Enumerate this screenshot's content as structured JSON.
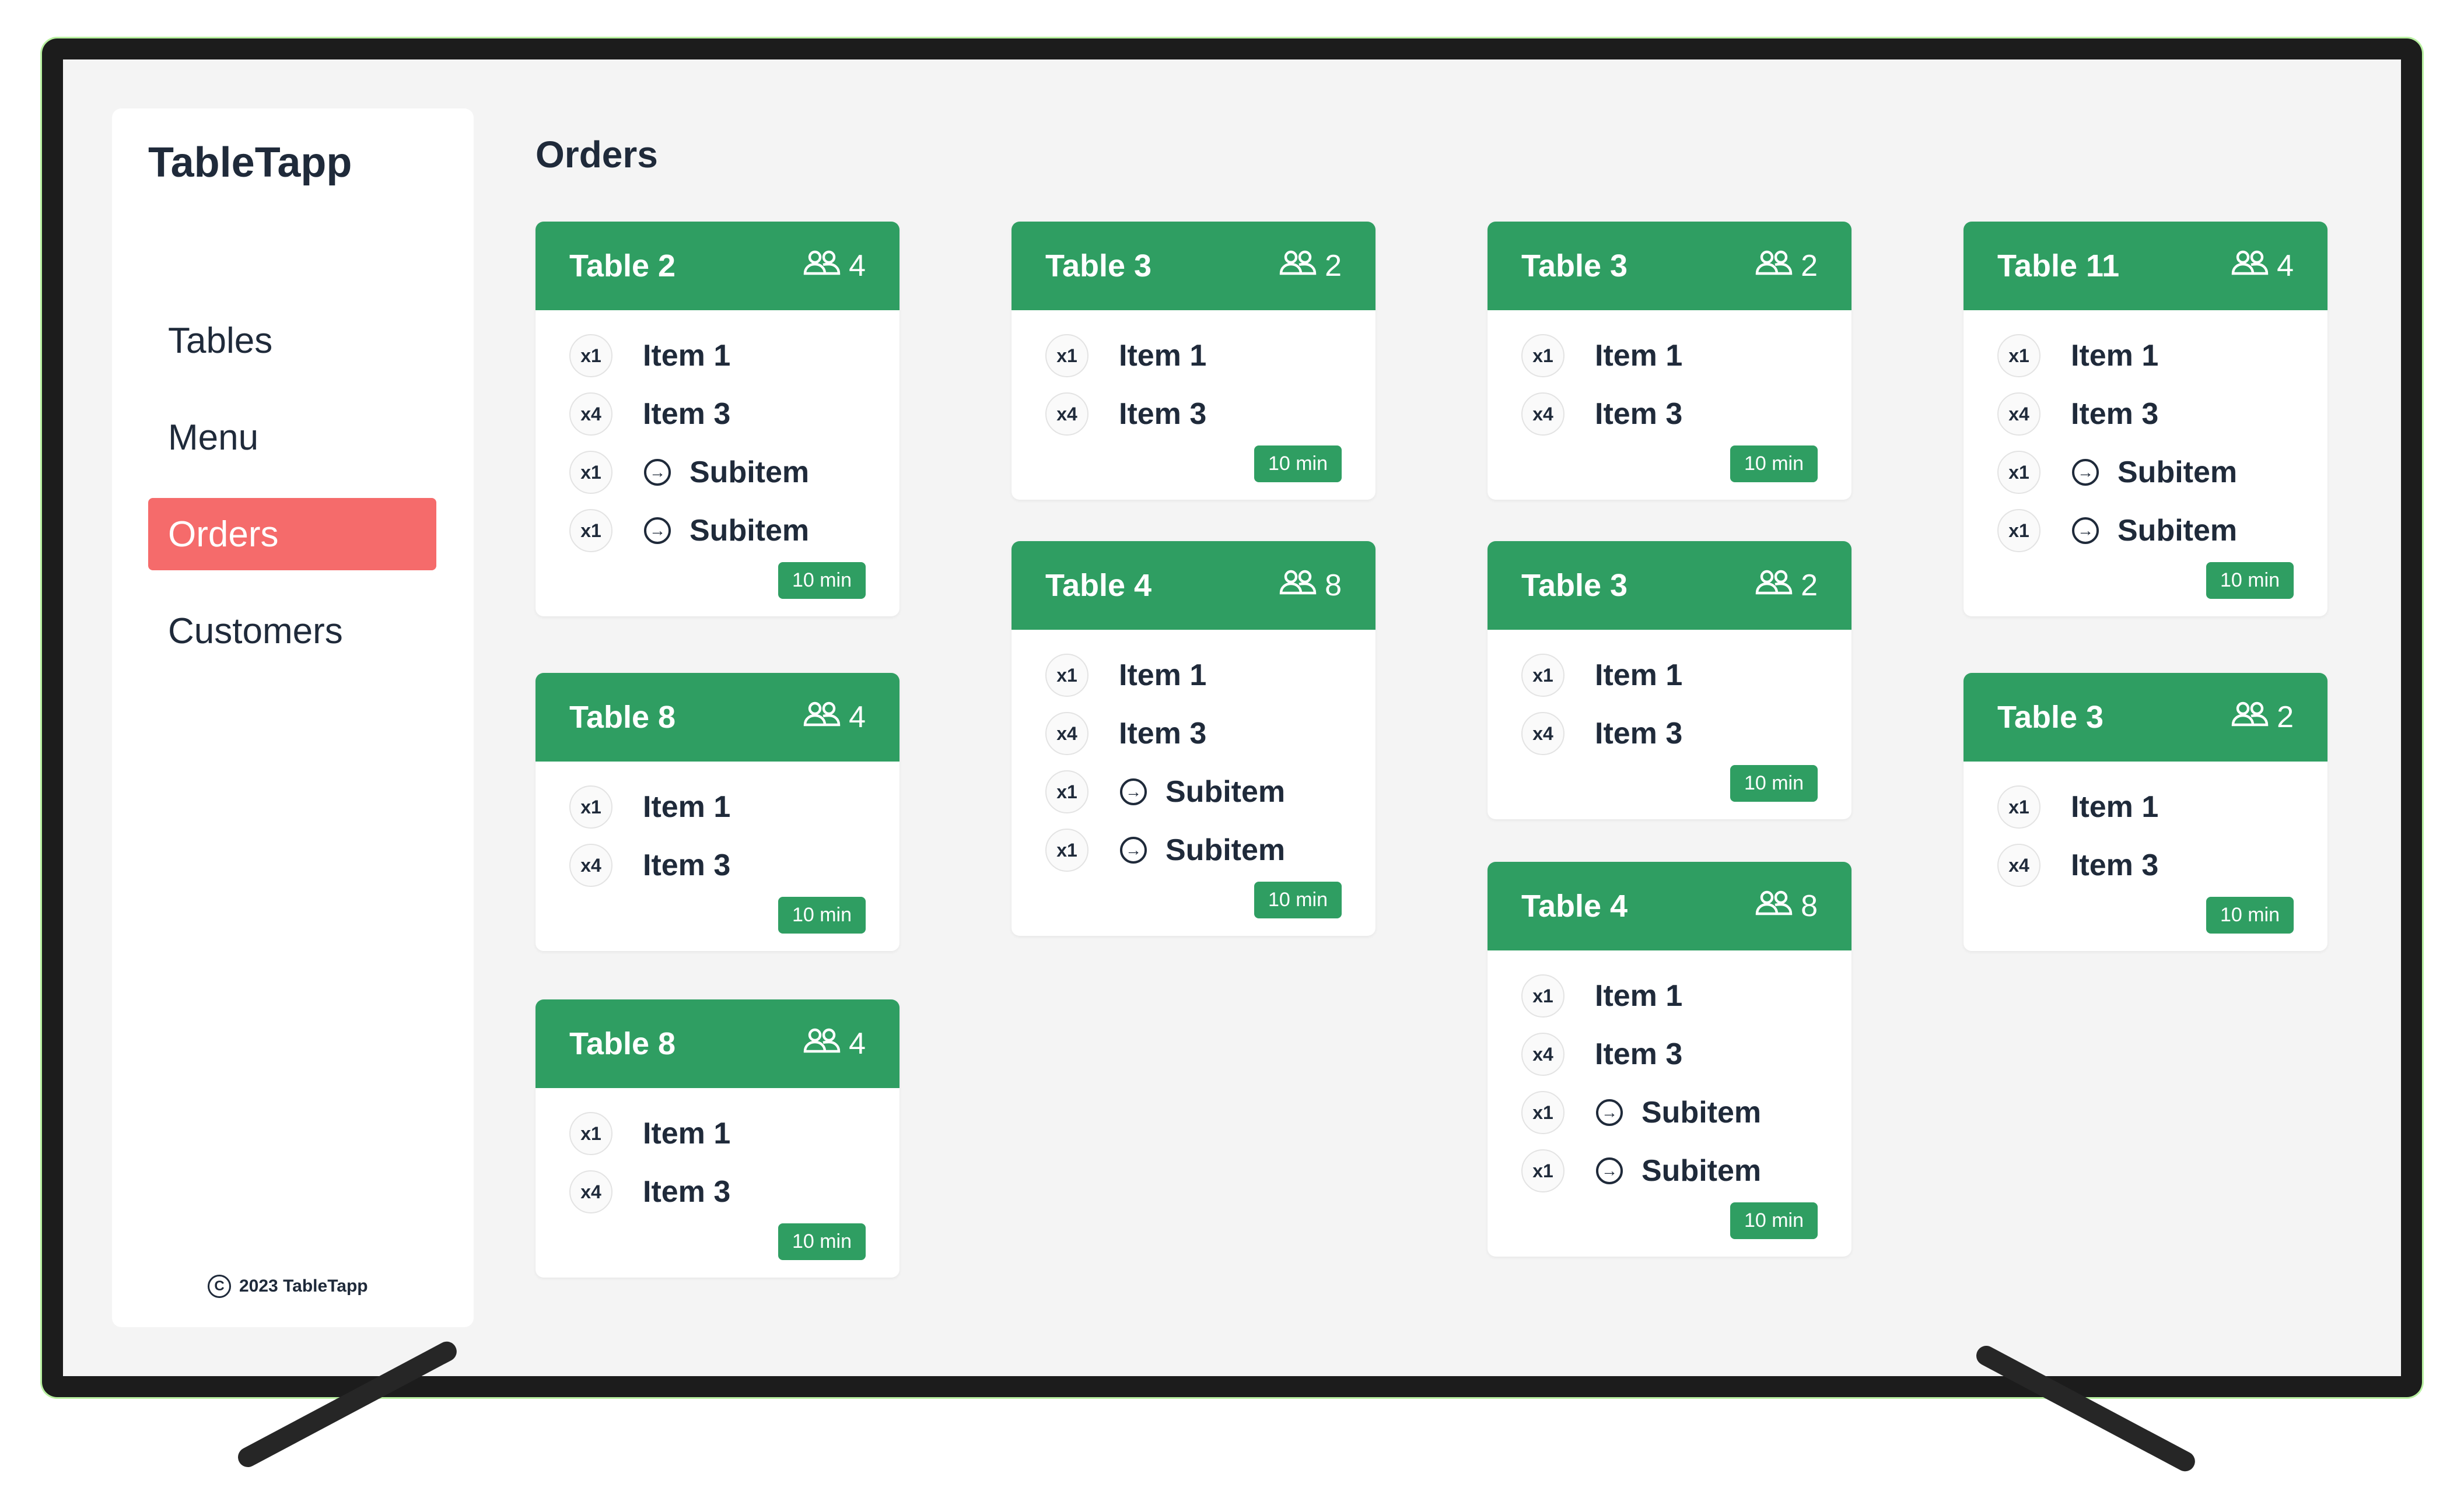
{
  "app": {
    "name": "TableTapp",
    "footer": "2023 TableTapp",
    "copyright_symbol": "C"
  },
  "nav": [
    {
      "label": "Tables",
      "active": false
    },
    {
      "label": "Menu",
      "active": false
    },
    {
      "label": "Orders",
      "active": true
    },
    {
      "label": "Customers",
      "active": false
    }
  ],
  "page": {
    "title": "Orders"
  },
  "colors": {
    "accent": "#2f9e62",
    "active_nav": "#f56b6b",
    "text": "#1f2a3a"
  },
  "icons": {
    "guests": "people-icon",
    "subitem": "arrow-circle-right-icon",
    "copyright": "copyright-icon"
  },
  "orders": [
    {
      "table": "Table 2",
      "guests": "4",
      "time": "10 min",
      "lines": [
        {
          "qty": "x1",
          "name": "Item 1",
          "sub": false
        },
        {
          "qty": "x4",
          "name": "Item 3",
          "sub": false
        },
        {
          "qty": "x1",
          "name": "Subitem",
          "sub": true
        },
        {
          "qty": "x1",
          "name": "Subitem",
          "sub": true
        }
      ]
    },
    {
      "table": "Table 8",
      "guests": "4",
      "time": "10 min",
      "lines": [
        {
          "qty": "x1",
          "name": "Item 1",
          "sub": false
        },
        {
          "qty": "x4",
          "name": "Item 3",
          "sub": false
        }
      ]
    },
    {
      "table": "Table 8",
      "guests": "4",
      "time": "10 min",
      "lines": [
        {
          "qty": "x1",
          "name": "Item 1",
          "sub": false
        },
        {
          "qty": "x4",
          "name": "Item 3",
          "sub": false
        }
      ]
    },
    {
      "table": "Table 3",
      "guests": "2",
      "time": "10 min",
      "lines": [
        {
          "qty": "x1",
          "name": "Item 1",
          "sub": false
        },
        {
          "qty": "x4",
          "name": "Item 3",
          "sub": false
        }
      ]
    },
    {
      "table": "Table 4",
      "guests": "8",
      "time": "10 min",
      "lines": [
        {
          "qty": "x1",
          "name": "Item 1",
          "sub": false
        },
        {
          "qty": "x4",
          "name": "Item 3",
          "sub": false
        },
        {
          "qty": "x1",
          "name": "Subitem",
          "sub": true
        },
        {
          "qty": "x1",
          "name": "Subitem",
          "sub": true
        }
      ]
    },
    {
      "table": "Table 3",
      "guests": "2",
      "time": "10 min",
      "lines": [
        {
          "qty": "x1",
          "name": "Item 1",
          "sub": false
        },
        {
          "qty": "x4",
          "name": "Item 3",
          "sub": false
        }
      ]
    },
    {
      "table": "Table 3",
      "guests": "2",
      "time": "10 min",
      "lines": [
        {
          "qty": "x1",
          "name": "Item 1",
          "sub": false
        },
        {
          "qty": "x4",
          "name": "Item 3",
          "sub": false
        }
      ]
    },
    {
      "table": "Table 4",
      "guests": "8",
      "time": "10 min",
      "lines": [
        {
          "qty": "x1",
          "name": "Item 1",
          "sub": false
        },
        {
          "qty": "x4",
          "name": "Item 3",
          "sub": false
        },
        {
          "qty": "x1",
          "name": "Subitem",
          "sub": true
        },
        {
          "qty": "x1",
          "name": "Subitem",
          "sub": true
        }
      ]
    },
    {
      "table": "Table 11",
      "guests": "4",
      "time": "10 min",
      "lines": [
        {
          "qty": "x1",
          "name": "Item 1",
          "sub": false
        },
        {
          "qty": "x4",
          "name": "Item 3",
          "sub": false
        },
        {
          "qty": "x1",
          "name": "Subitem",
          "sub": true
        },
        {
          "qty": "x1",
          "name": "Subitem",
          "sub": true
        }
      ]
    },
    {
      "table": "Table 3",
      "guests": "2",
      "time": "10 min",
      "lines": [
        {
          "qty": "x1",
          "name": "Item 1",
          "sub": false
        },
        {
          "qty": "x4",
          "name": "Item 3",
          "sub": false
        }
      ]
    }
  ]
}
